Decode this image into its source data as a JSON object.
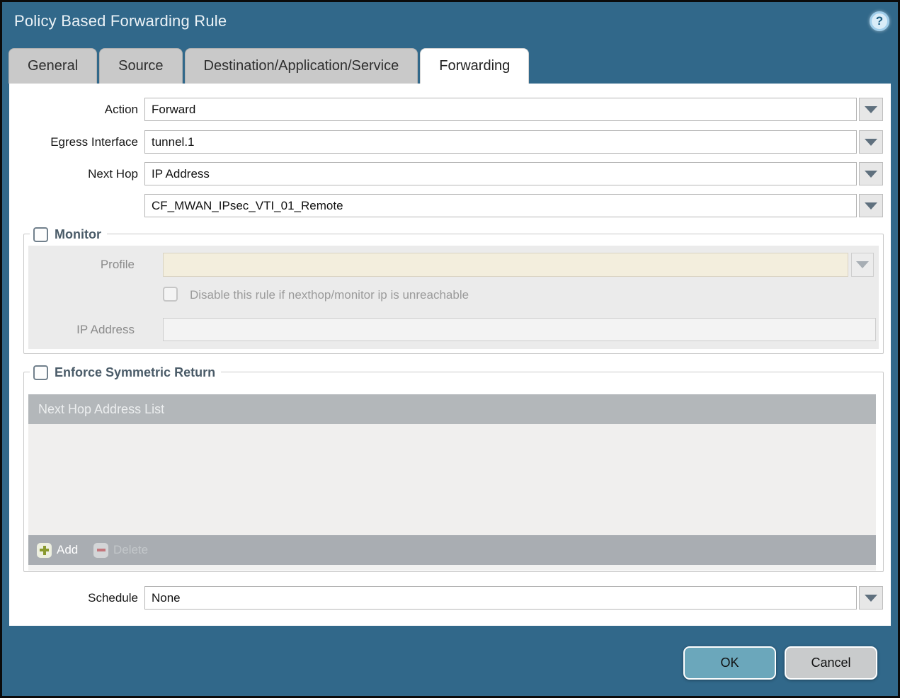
{
  "dialog": {
    "title": "Policy Based Forwarding Rule",
    "help_glyph": "?"
  },
  "tabs": [
    {
      "label": "General",
      "active": false
    },
    {
      "label": "Source",
      "active": false
    },
    {
      "label": "Destination/Application/Service",
      "active": false
    },
    {
      "label": "Forwarding",
      "active": true
    }
  ],
  "form": {
    "action": {
      "label": "Action",
      "value": "Forward"
    },
    "egress_interface": {
      "label": "Egress Interface",
      "value": "tunnel.1"
    },
    "next_hop": {
      "label": "Next Hop",
      "value": "IP Address"
    },
    "next_hop_address": {
      "value": "CF_MWAN_IPsec_VTI_01_Remote"
    },
    "schedule": {
      "label": "Schedule",
      "value": "None"
    }
  },
  "monitor": {
    "label": "Monitor",
    "checked": false,
    "profile": {
      "label": "Profile",
      "value": ""
    },
    "disable_rule": {
      "label": "Disable this rule if nexthop/monitor ip is unreachable",
      "checked": false
    },
    "ip_address": {
      "label": "IP Address",
      "value": ""
    }
  },
  "enforce_symmetric_return": {
    "label": "Enforce Symmetric Return",
    "checked": false,
    "table": {
      "header": "Next Hop Address List",
      "rows": []
    },
    "add_label": "Add",
    "delete_label": "Delete"
  },
  "footer": {
    "ok_label": "OK",
    "cancel_label": "Cancel"
  },
  "icons": {
    "help": "question-mark-circle",
    "dropdown": "chevron-down",
    "add": "plus",
    "delete": "minus"
  },
  "colors": {
    "chrome": "#31688a",
    "tab_inactive": "#c9c9c9",
    "ok_button": "#6ba7bb",
    "cancel_button": "#c9cbcc",
    "profile_field_disabled": "#f3eedd",
    "table_header": "#b3b7ba",
    "toolbar": "#a9adb2",
    "add_plus": "#8a9a2e",
    "delete_minus": "#c4767c",
    "section_label": "#4a5b68",
    "panel": "#ebebeb"
  }
}
